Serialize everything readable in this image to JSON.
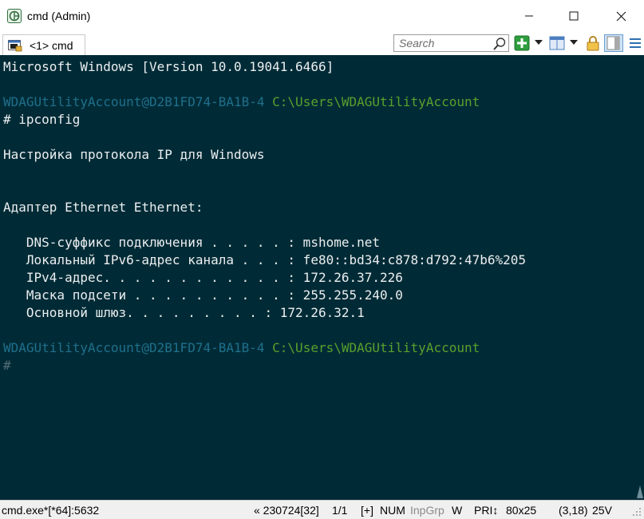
{
  "window": {
    "title": "cmd (Admin)",
    "icon": "conemu-app-icon"
  },
  "tabs": [
    {
      "label": "<1> cmd",
      "icon": "console-tab-icon",
      "active": true
    }
  ],
  "toolbar": {
    "search_placeholder": "Search",
    "icons": [
      "search-icon",
      "new-console-icon",
      "split-icon",
      "lock-icon",
      "panel-icon",
      "menu-icon"
    ]
  },
  "console": {
    "lines": [
      {
        "text": "Microsoft Windows [Version 10.0.19041.6466]"
      },
      {
        "text": ""
      },
      {
        "user": "WDAGUtilityAccount@D2B1FD74-BA1B-4",
        "path": "C:\\Users\\WDAGUtilityAccount"
      },
      {
        "text": "# ipconfig"
      },
      {
        "text": ""
      },
      {
        "text": "Настройка протокола IP для Windows"
      },
      {
        "text": ""
      },
      {
        "text": ""
      },
      {
        "text": "Адаптер Ethernet Ethernet:"
      },
      {
        "text": ""
      },
      {
        "text": "   DNS-суффикс подключения . . . . . : mshome.net"
      },
      {
        "text": "   Локальный IPv6-адрес канала . . . : fe80::bd34:c878:d792:47b6%205"
      },
      {
        "text": "   IPv4-адрес. . . . . . . . . . . . : 172.26.37.226"
      },
      {
        "text": "   Маска подсети . . . . . . . . . . : 255.255.240.0"
      },
      {
        "text": "   Основной шлюз. . . . . . . . . : 172.26.32.1"
      },
      {
        "text": ""
      },
      {
        "user": "WDAGUtilityAccount@D2B1FD74-BA1B-4",
        "path": "C:\\Users\\WDAGUtilityAccount"
      },
      {
        "prompt": "#"
      }
    ],
    "colors": {
      "background": "#002b36",
      "text": "#ebeef0",
      "user": "#1f6f8c",
      "path": "#5aa02c"
    }
  },
  "statusbar": {
    "process": "cmd.exe*[*64]:5632",
    "build": "« 230724[32]",
    "pages": "1/1",
    "plus": "[+]",
    "num": "NUM",
    "inpgrp": "InpGrp",
    "w": "W",
    "pri": "PRI↕",
    "size": "80x25",
    "cursor": "(3,18)",
    "voltage": "25V"
  }
}
